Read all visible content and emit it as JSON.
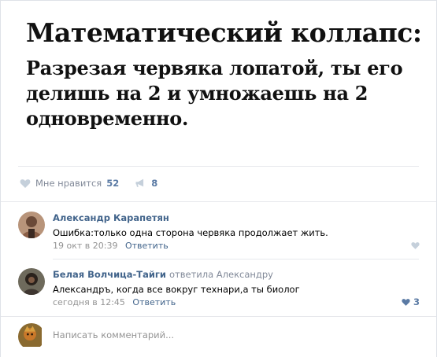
{
  "post": {
    "meme_title": "Математический коллапс:",
    "meme_body": "Разрезая червяка лопатой, ты его делишь на 2 и умножаешь на 2 одновременно.",
    "likes_label": "Мне нравится",
    "likes_count": "52",
    "shares_count": "8"
  },
  "comments": [
    {
      "author": "Александр Карапетян",
      "text": "Ошибка:только одна сторона червяка продолжает жить.",
      "time": "19 окт в 20:39",
      "reply_label": "Ответить",
      "like_count": ""
    },
    {
      "author": "Белая Волчица-Тайги",
      "reply_to": "ответила Александру",
      "text": "Александръ, когда все вокруг технари,а ты биолог",
      "time": "сегодня в 12:45",
      "reply_label": "Ответить",
      "like_count": "3"
    }
  ],
  "composer": {
    "placeholder": "Написать комментарий..."
  },
  "colors": {
    "link": "#42648b",
    "muted": "#828a99",
    "like": "#5a7aa4",
    "divider": "#e7e8ec"
  }
}
